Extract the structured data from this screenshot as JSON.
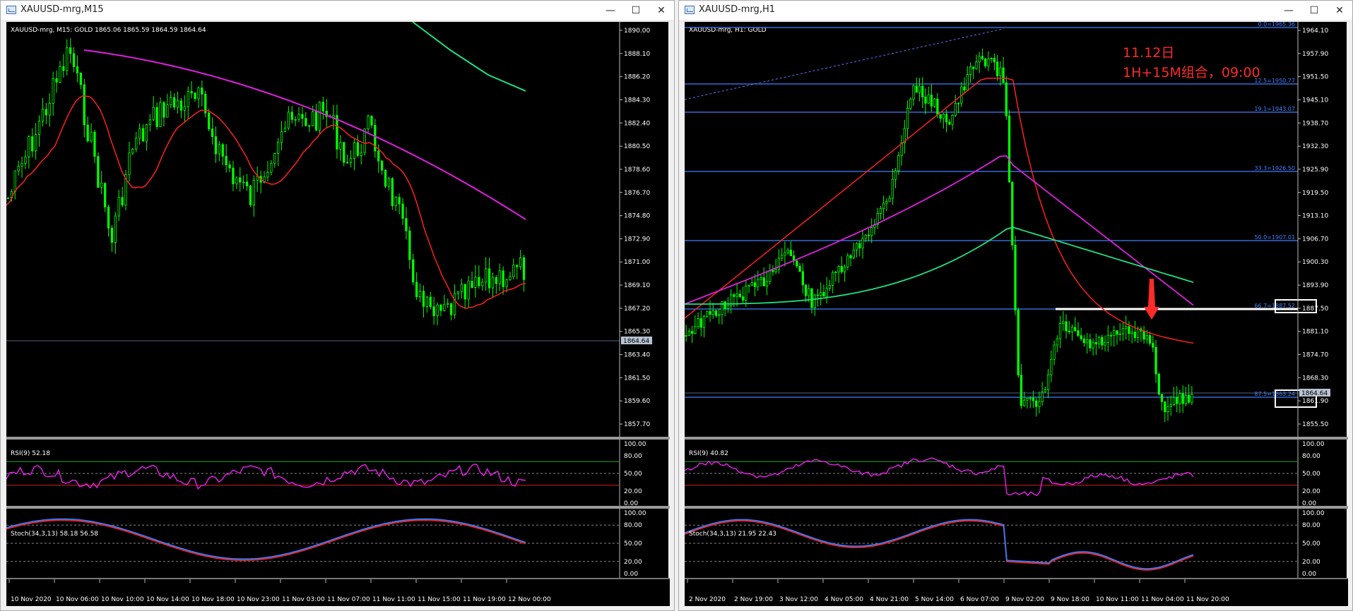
{
  "left_window": {
    "title": "XAUUSD-mrg,M15",
    "buttons": {
      "minimize": "—",
      "maximize": "☐",
      "close": "✕"
    },
    "header": "XAUUSD-mrg, M15:  GOLD  1865.06 1865.59 1864.59 1864.64",
    "price_ticks": [
      "1890.00",
      "1888.10",
      "1886.20",
      "1884.30",
      "1882.40",
      "1880.50",
      "1878.60",
      "1876.70",
      "1874.80",
      "1872.90",
      "1871.00",
      "1869.10",
      "1867.20",
      "1865.30",
      "1863.40",
      "1861.50",
      "1859.60",
      "1857.70"
    ],
    "current_price": "1864.64",
    "rsi_label": "RSI(9) 52.18",
    "rsi_ticks": [
      "100.00",
      "80.00",
      "50.00",
      "20.00",
      "0.00"
    ],
    "stoch_label": "Stoch(34,3,13) 58.18 56.58",
    "stoch_ticks": [
      "100.00",
      "80.00",
      "50.00",
      "20.00",
      "0.00"
    ],
    "time_labels": [
      "10 Nov 2020",
      "10 Nov 06:00",
      "10 Nov 10:00",
      "10 Nov 14:00",
      "10 Nov 18:00",
      "10 Nov 23:00",
      "11 Nov 03:00",
      "11 Nov 07:00",
      "11 Nov 11:00",
      "11 Nov 15:00",
      "11 Nov 19:00",
      "12 Nov 00:00"
    ]
  },
  "right_window": {
    "title": "XAUUSD-mrg,H1",
    "buttons": {
      "minimize": "—",
      "maximize": "☐",
      "close": "✕"
    },
    "header": "XAUUSD-mrg, H1:  GOLD",
    "price_ticks": [
      "1964.10",
      "1957.90",
      "1951.50",
      "1945.10",
      "1938.70",
      "1932.30",
      "1925.90",
      "1919.50",
      "1913.10",
      "1906.70",
      "1900.30",
      "1893.90",
      "1887.50",
      "1881.10",
      "1874.70",
      "1868.30",
      "1861.90",
      "1855.50"
    ],
    "current_price": "1864.64",
    "fib_labels": [
      "0.0=1965.36",
      "12.5=1950.77",
      "19.1=1943.07",
      "33.3=1926.50",
      "50.0=1907.01",
      "66.7=1887.52",
      "87.5=1863.24"
    ],
    "annotation_line1": "11.12日",
    "annotation_line2": "1H+15M组合，09:00",
    "rsi_label": "RSI(9) 40.82",
    "rsi_ticks": [
      "100.00",
      "80.00",
      "50.00",
      "20.00",
      "0.00"
    ],
    "stoch_label": "Stoch(34,3,13) 21.95 22.43",
    "stoch_ticks": [
      "100.00",
      "80.00",
      "50.00",
      "20.00",
      "0.00"
    ],
    "time_labels": [
      "2 Nov 2020",
      "2 Nov 19:00",
      "3 Nov 12:00",
      "4 Nov 05:00",
      "4 Nov 21:00",
      "5 Nov 14:00",
      "6 Nov 07:00",
      "9 Nov 02:00",
      "9 Nov 18:00",
      "10 Nov 11:00",
      "11 Nov 04:00",
      "11 Nov 20:00"
    ]
  },
  "colors": {
    "background": "#000000",
    "candle": "#00ff00",
    "ma_fast": "#ff2020",
    "ma_mid": "#e020e0",
    "ma_slow": "#20e080",
    "fib_line": "#4080ff",
    "rsi": "#ff20ff",
    "stoch_main": "#3080ff",
    "stoch_signal": "#ff2020",
    "annotation": "#ff2a2a"
  }
}
